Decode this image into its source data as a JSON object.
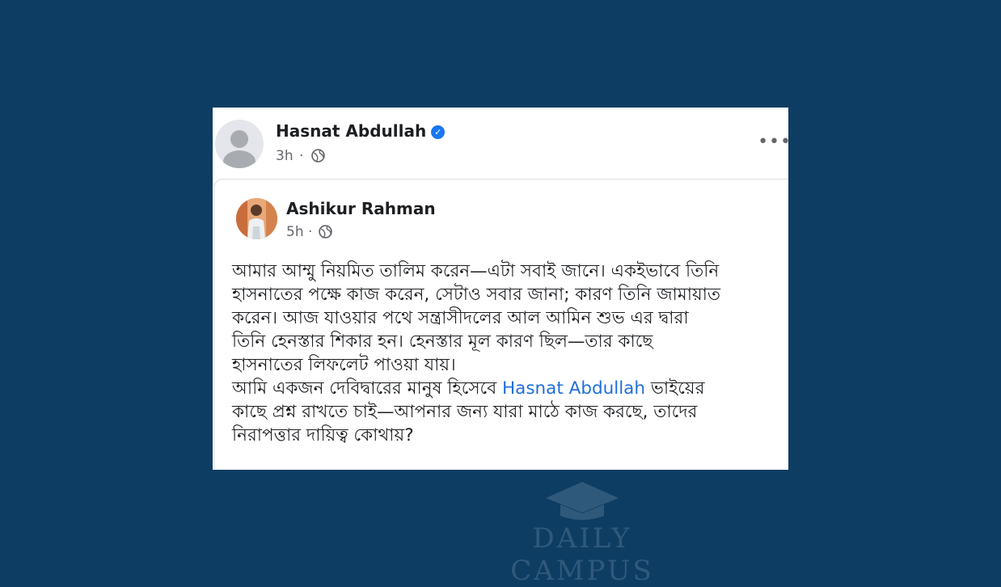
{
  "post": {
    "author": "Hasnat Abdullah",
    "time": "3h",
    "separator": "·",
    "more_label": "•••"
  },
  "shared_post": {
    "author": "Ashikur Rahman",
    "time": "5h",
    "separator": "·",
    "text_part1": "আমার আম্মু নিয়মিত তালিম করেন—এটা সবাই জানে। একইভাবে তিনি\nহাসনাতের পক্ষে কাজ করেন, সেটাও সবার জানা; কারণ তিনি জামায়াত\nকরেন। আজ যাওয়ার পথে  সন্ত্রাসীদলের আল আমিন শুভ এর  দ্বারা\nতিনি হেনস্তার শিকার হন। হেনস্তার মূল কারণ ছিল—তার কাছে\nহাসনাতের লিফলেট পাওয়া যায়।\nআমি একজন দেবিদ্বারের মানুষ হিসেবে ",
    "mention": "Hasnat Abdullah",
    "text_part2": " ভাইয়ের\nকাছে প্রশ্ন রাখতে চাই—আপনার জন্য যারা মাঠে কাজ করছে, তাদের\nনিরাপত্তার দায়িত্ব কোথায়?"
  },
  "watermark": {
    "text": "DAILY CAMPUS"
  },
  "icons": {
    "verified": "verified-badge-icon",
    "globe": "globe-icon",
    "more": "more-options-icon"
  },
  "colors": {
    "background": "#0e3d63",
    "card": "#ffffff",
    "mention": "#216fdb",
    "verified": "#1877f2",
    "meta_text": "#65676b"
  }
}
